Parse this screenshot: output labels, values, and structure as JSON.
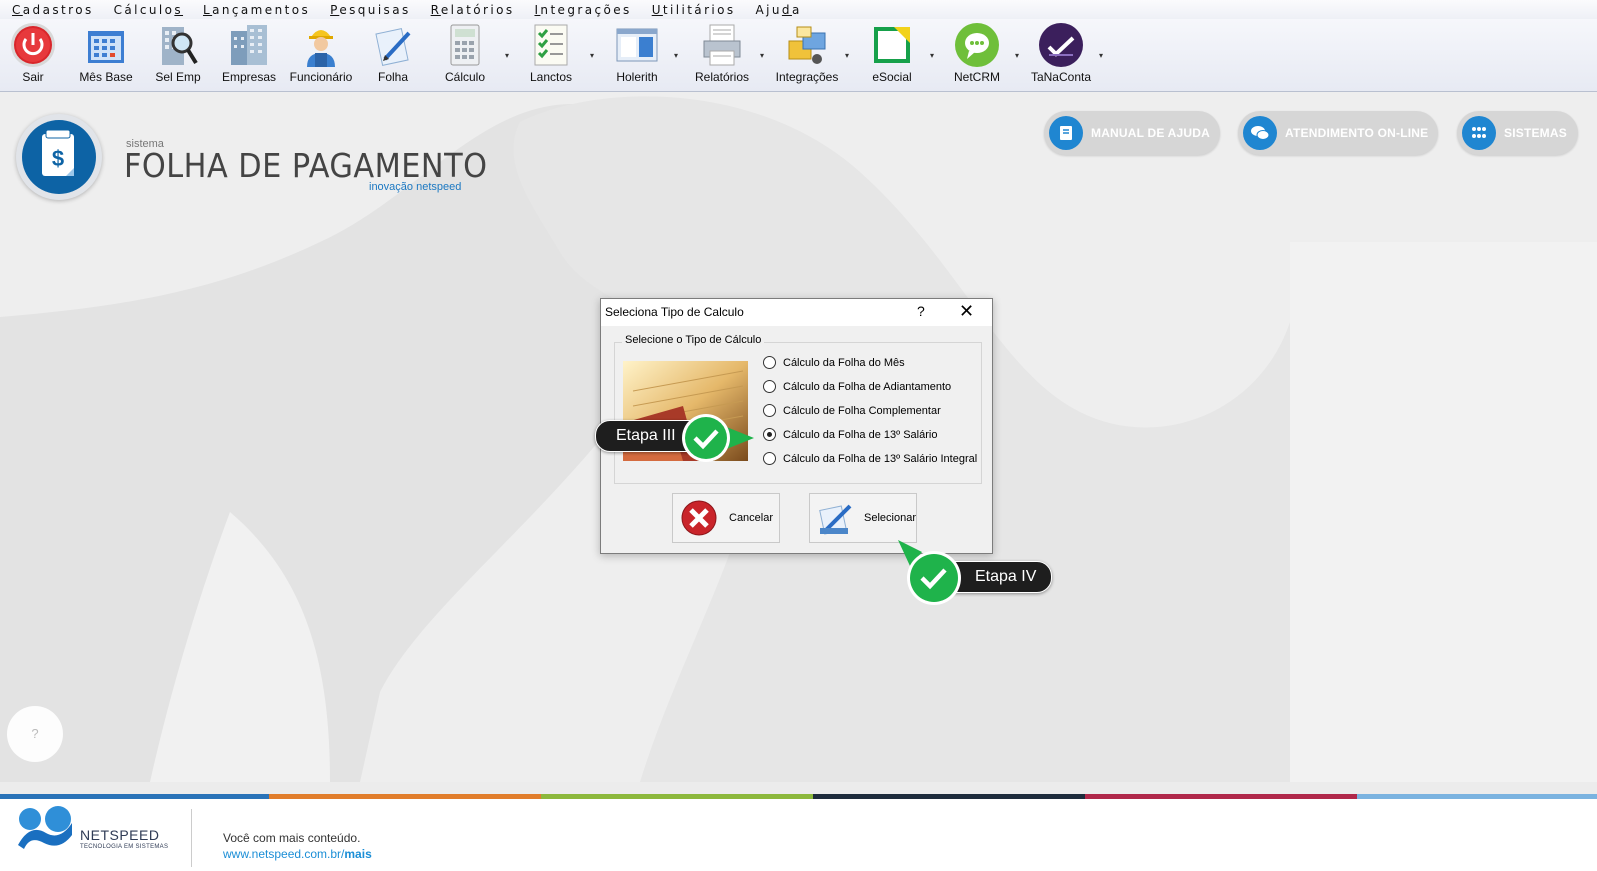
{
  "menu": [
    {
      "label": "Cadastros",
      "mnemonic_index": 0
    },
    {
      "label": "Cálculos",
      "mnemonic_index": 7
    },
    {
      "label": "Lançamentos",
      "mnemonic_index": 0
    },
    {
      "label": "Pesquisas",
      "mnemonic_index": 0
    },
    {
      "label": "Relatórios",
      "mnemonic_index": 0
    },
    {
      "label": "Integrações",
      "mnemonic_index": 0
    },
    {
      "label": "Utilitários",
      "mnemonic_index": 0
    },
    {
      "label": "Ajuda",
      "mnemonic_index": 3
    }
  ],
  "toolbar": {
    "sair": "Sair",
    "mes_base": "Mês Base",
    "sel_emp": "Sel Emp",
    "empresas": "Empresas",
    "funcionario": "Funcionário",
    "folha": "Folha",
    "calculo": "Cálculo",
    "lanctos": "Lanctos",
    "holerith": "Holerith",
    "relatorios": "Relatórios",
    "integracoes": "Integrações",
    "esocial": "eSocial",
    "netcrm": "NetCRM",
    "tanaconta": "TaNaConta",
    "dropdown_glyph": "▾"
  },
  "brand": {
    "small": "sistema",
    "title": "FOLHA DE PAGAMENTO",
    "sub": "inovação netspeed"
  },
  "top_buttons": {
    "manual": "MANUAL DE AJUDA",
    "atendimento": "ATENDIMENTO ON-LINE",
    "sistemas": "SISTEMAS"
  },
  "help_circle": "?",
  "dialog": {
    "title": "Seleciona Tipo de Calculo",
    "help": "?",
    "close": "✕",
    "group_label": "Selecione o Tipo de Cálculo",
    "options": [
      {
        "label": "Cálculo da Folha do Mês",
        "selected": false
      },
      {
        "label": "Cálculo da Folha de Adiantamento",
        "selected": false
      },
      {
        "label": "Cálculo de Folha Complementar",
        "selected": false
      },
      {
        "label": "Cálculo da Folha de 13º Salário",
        "selected": true
      },
      {
        "label": "Cálculo da Folha de 13º Salário Integral",
        "selected": false
      }
    ],
    "cancel": "Cancelar",
    "select": "Selecionar"
  },
  "callouts": {
    "step3": "Etapa III",
    "step4": "Etapa IV"
  },
  "colors": {
    "accent_blue": "#1f86d1",
    "check_green": "#1fb34b",
    "stripe": [
      "#2a73b8",
      "#e17d2b",
      "#8cb83c",
      "#1e2c3c",
      "#b0284a",
      "#7bb3e0"
    ]
  },
  "footer": {
    "company": "NETSPEED",
    "tagline": "TECNOLOGIA EM SISTEMAS",
    "line1": "Você com mais conteúdo.",
    "line2_prefix": "www.netspeed.com.br/",
    "line2_bold": "mais"
  }
}
